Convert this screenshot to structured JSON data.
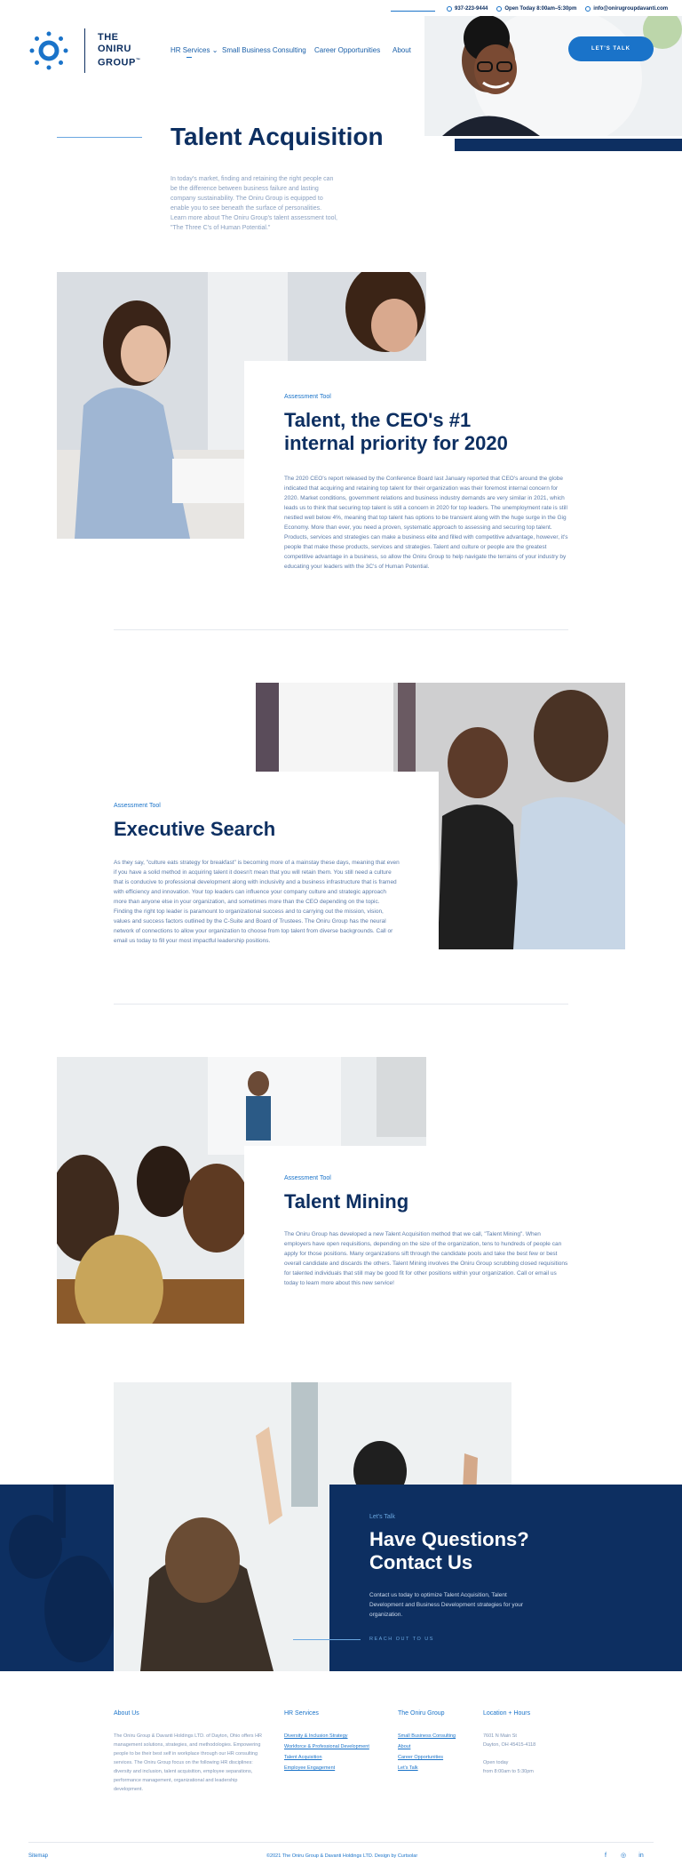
{
  "topbar": {
    "phone": "937-223-9444",
    "hours": "Open Today 8:00am–5:30pm",
    "email": "info@onirugroupdavanti.com"
  },
  "logo": {
    "line1": "THE",
    "line2": "ONIRU",
    "line3": "GROUP",
    "tm": "™"
  },
  "nav": {
    "items": [
      {
        "label": "HR Services"
      },
      {
        "label": "Small Business Consulting"
      },
      {
        "label": "Career Opportunities"
      },
      {
        "label": "About"
      }
    ],
    "cta": "LET'S TALK"
  },
  "hero": {
    "title": "Talent Acquisition",
    "text": "In today's market, finding and retaining the right people can be the difference between business failure and lasting company sustainability. The Oniru Group is equipped to enable you to see beneath the surface of personalities. Learn more about The Oniru Group's talent assessment tool, \"The Three C's of Human Potential.\""
  },
  "sections": [
    {
      "tag": "Assessment Tool",
      "title": "Talent, the CEO's #1 internal priority for 2020",
      "text": "The 2020 CEO's report released by the Conference Board last January reported that CEO's around the globe indicated that acquiring and retaining top talent for their organization was their foremost internal concern for 2020. Market conditions, government relations and business industry demands are very similar in 2021, which leads us to think that securing top talent is still a concern in 2020 for top leaders. The unemployment rate is still nestled well below 4%, meaning that top talent has options to be transient along with the huge surge in the Gig Economy. More than ever, you need a proven, systematic approach to assessing and securing top talent. Products, services and strategies can make a business elite and filled with competitive advantage, however, it's people that make these products, services and strategies. Talent and culture or people are the greatest competitive advantage in a business, so allow the Oniru Group to help navigate the terrains of your industry by educating your leaders with the 3C's of Human Potential."
    },
    {
      "tag": "Assessment Tool",
      "title": "Executive Search",
      "text": "As they say, \"culture eats strategy for breakfast\" is becoming more of a mainstay these days, meaning that even if you have a solid method in acquiring talent it doesn't mean that you will retain them. You still need a culture that is conducive to professional development along with inclusivity and a business infrastructure that is framed with efficiency and innovation. Your top leaders can influence your company culture and strategic approach more than anyone else in your organization, and sometimes more than the CEO depending on the topic. Finding the right top leader is paramount to organizational success and to carrying out the mission, vision, values and success factors outlined by the C-Suite and Board of Trustees. The Oniru Group has the neural network of connections to allow your organization to choose from top talent from diverse backgrounds. Call or email us today to fill your most impactful leadership positions."
    },
    {
      "tag": "Assessment Tool",
      "title": "Talent Mining",
      "text": "The Oniru Group has developed a new Talent Acquisition method that we call, \"Talent Mining\". When employers have open requisitions, depending on the size of the organization, tens to hundreds of people can apply for those positions. Many organizations sift through the candidate pools and take the best few or best overall candidate and discards the others. Talent Mining involves the Oniru Group scrubbing closed requisitions for talented individuals that still may be good fit for other positions within your organization. Call or email us today to learn more about this new service!"
    }
  ],
  "contact": {
    "tag": "Let's Talk",
    "title_line1": "Have Questions?",
    "title_line2": "Contact Us",
    "text": "Contact us today to optimize Talent Acquisition, Talent Development and Business Development strategies for your organization.",
    "link": "REACH OUT TO US"
  },
  "footer": {
    "about_head": "About Us",
    "about_text": "The Oniru Group & Davanti Holdings LTD. of Dayton, Ohio offers HR management solutions, strategies, and methodologies. Empowering people to be their best self in workplace through our HR consulting services. The Oniru Group focus on the following HR disciplines: diversity and inclusion, talent acquisition, employee separations, performance management, organizational and leadership development.",
    "hr_head": "HR Services",
    "hr_links": [
      "Diversity & Inclusion Strategy",
      "Workforce & Professional Development",
      "Talent Acquisition",
      "Employee Engagement"
    ],
    "group_head": "The Oniru Group",
    "group_links": [
      "Small Business Consulting",
      "About",
      "Career Opportunities",
      "Let's Talk"
    ],
    "loc_head": "Location + Hours",
    "address1": "7601 N Main St",
    "address2": "Dayton, OH 45415-4118",
    "open": "Open today",
    "hours": "from 8:00am to 5:30pm",
    "sitemap": "Sitemap",
    "copyright": "©2021 The Oniru Group & Davanti Holdings LTD. Design by Curtsolar",
    "social": [
      "f",
      "◎",
      "in"
    ]
  },
  "colors": {
    "navy": "#0d2f61",
    "accent": "#1a73c9"
  }
}
